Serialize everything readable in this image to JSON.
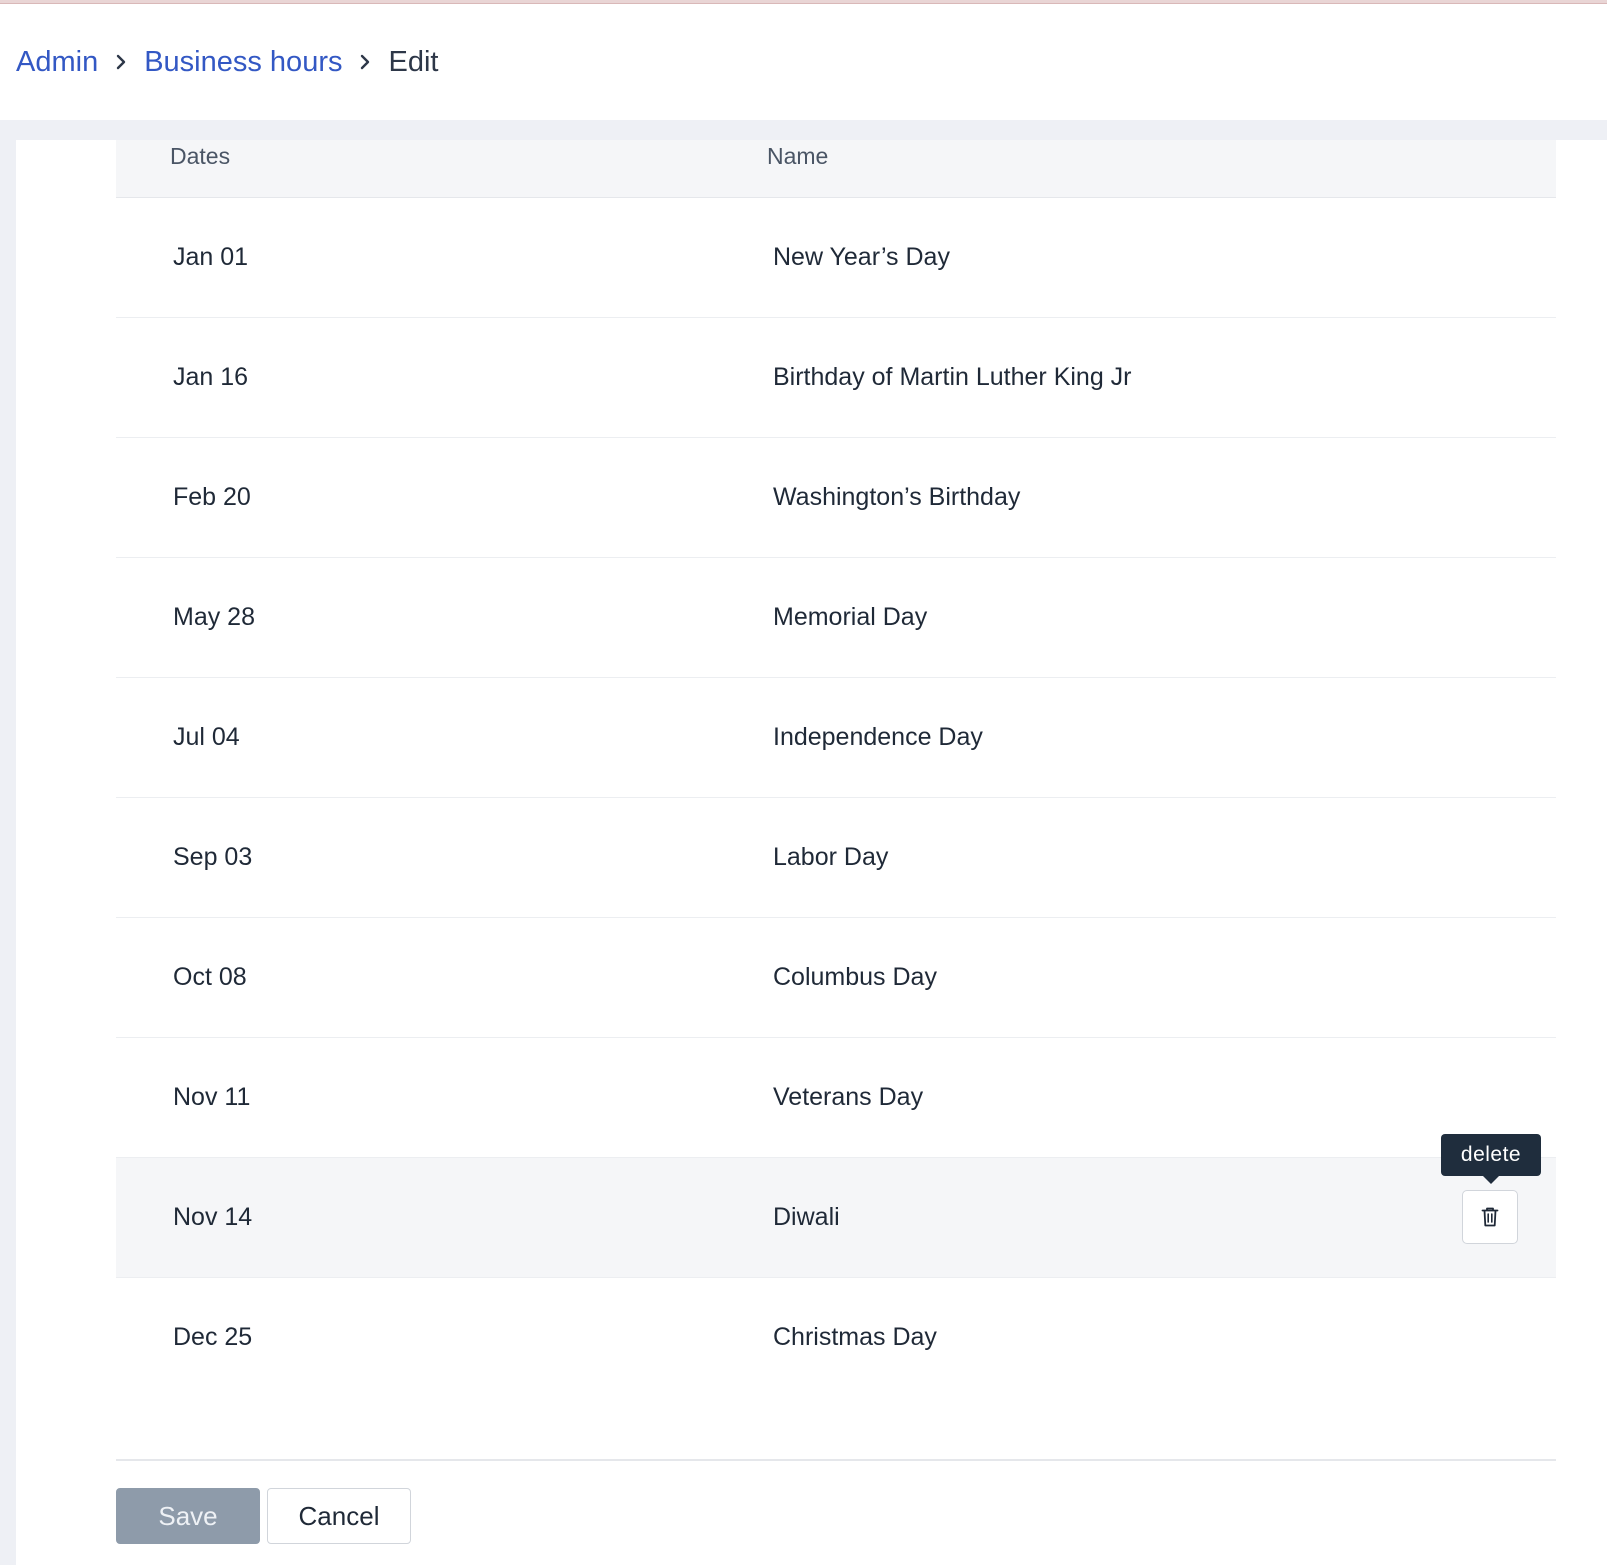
{
  "breadcrumb": {
    "items": [
      {
        "label": "Admin",
        "link": true
      },
      {
        "label": "Business hours",
        "link": true
      },
      {
        "label": "Edit",
        "link": false
      }
    ],
    "separator_icon": "chevron-right-icon"
  },
  "table": {
    "columns": {
      "dates": "Dates",
      "name": "Name"
    },
    "rows": [
      {
        "date": "Jan 01",
        "name": "New Year’s Day"
      },
      {
        "date": "Jan 16",
        "name": "Birthday of Martin Luther King Jr"
      },
      {
        "date": "Feb 20",
        "name": "Washington’s Birthday"
      },
      {
        "date": "May 28",
        "name": "Memorial Day"
      },
      {
        "date": "Jul 04",
        "name": "Independence Day"
      },
      {
        "date": "Sep 03",
        "name": "Labor Day"
      },
      {
        "date": "Oct 08",
        "name": "Columbus Day"
      },
      {
        "date": "Nov 11",
        "name": "Veterans Day"
      },
      {
        "date": "Nov 14",
        "name": "Diwali"
      },
      {
        "date": "Dec 25",
        "name": "Christmas Day"
      }
    ],
    "hovered_row_index": 8,
    "delete_icon": "trash-icon",
    "delete_tooltip": "delete"
  },
  "actions": {
    "save_label": "Save",
    "cancel_label": "Cancel"
  },
  "colors": {
    "link": "#3358c4",
    "tooltip_bg": "#1f2d3d",
    "save_disabled": "#8e9baa",
    "page_bg": "#eef0f5"
  }
}
